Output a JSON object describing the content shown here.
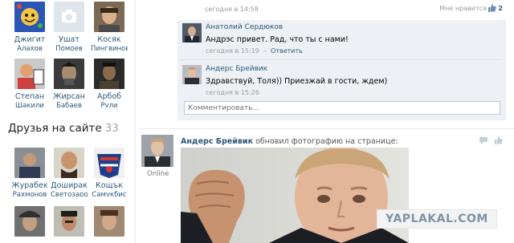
{
  "friends": [
    {
      "first": "Джигит",
      "last": "Алахов"
    },
    {
      "first": "Ушат",
      "last": "Помоев"
    },
    {
      "first": "Косяк",
      "last": "Пингвинов"
    },
    {
      "first": "Степан",
      "last": "Шакили"
    },
    {
      "first": "Жирсан",
      "last": "Бабаев"
    },
    {
      "first": "Арбоб",
      "last": "Рули"
    }
  ],
  "online_section": {
    "title": "Друзья на сайте",
    "count": "33"
  },
  "online_friends": [
    {
      "first": "Журабек",
      "last": "Рахмонов"
    },
    {
      "first": "Доширак",
      "last": "Светозаров"
    },
    {
      "first": "Кощък",
      "last": "Самукбиc"
    },
    {
      "first": "",
      "last": ""
    },
    {
      "first": "",
      "last": ""
    },
    {
      "first": "",
      "last": ""
    }
  ],
  "post1": {
    "time": "сегодня в 14:58",
    "like_label": "Мне нравится",
    "like_count": "2"
  },
  "comments": [
    {
      "author": "Анатолий Сердюков",
      "text": "Андрэс привет. Рад, что ты с нами!",
      "time": "сегодня в 15:19",
      "reply": "Ответить"
    },
    {
      "author": "Андерс Брейвик",
      "text": "Здравствуй, Толя)) Приезжай в гости, ждем)",
      "time": "сегодня в 15:26",
      "reply": ""
    }
  ],
  "comment_input": {
    "placeholder": "Комментировать..."
  },
  "post2": {
    "author": "Андерс Брейвик",
    "action": "обновил фотографию на странице:",
    "status": "Online"
  },
  "watermark": "YAPLAKAL.COM",
  "colors": {
    "link": "#2b587a",
    "comment_bg": "#edf1f5",
    "muted": "#999999"
  }
}
